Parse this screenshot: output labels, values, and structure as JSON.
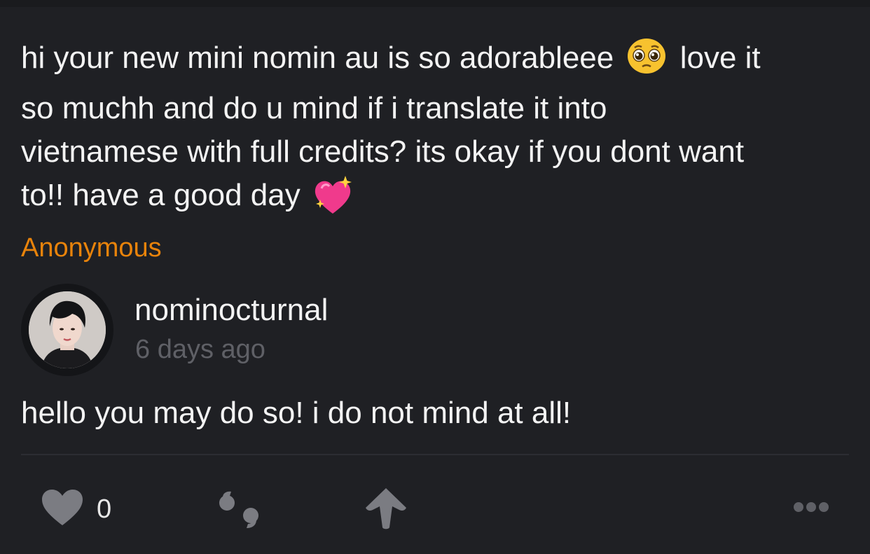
{
  "question": {
    "line1_part1": "hi your new mini nomin au is so adorableee",
    "line1_part2": "love it",
    "line2": "so muchh and do u mind if i translate it into",
    "line3": "vietnamese with full credits? its okay if you dont want",
    "line4": "to!! have a good day",
    "emojis": [
      "pleading-face",
      "sparkling-heart"
    ]
  },
  "asker": "Anonymous",
  "answerer": {
    "name": "nominocturnal",
    "timestamp": "6 days ago"
  },
  "answer": "hello you may do so! i do not mind at all!",
  "actions": {
    "like_count": "0",
    "icons": [
      "heart-icon",
      "quote-icon",
      "boost-arrow-icon",
      "more-dots-icon"
    ]
  },
  "colors": {
    "background": "#1f2024",
    "text": "#f3f3f3",
    "accent_orange": "#e8830b",
    "muted": "#5f6066",
    "icon_gray": "#7b7c82"
  }
}
